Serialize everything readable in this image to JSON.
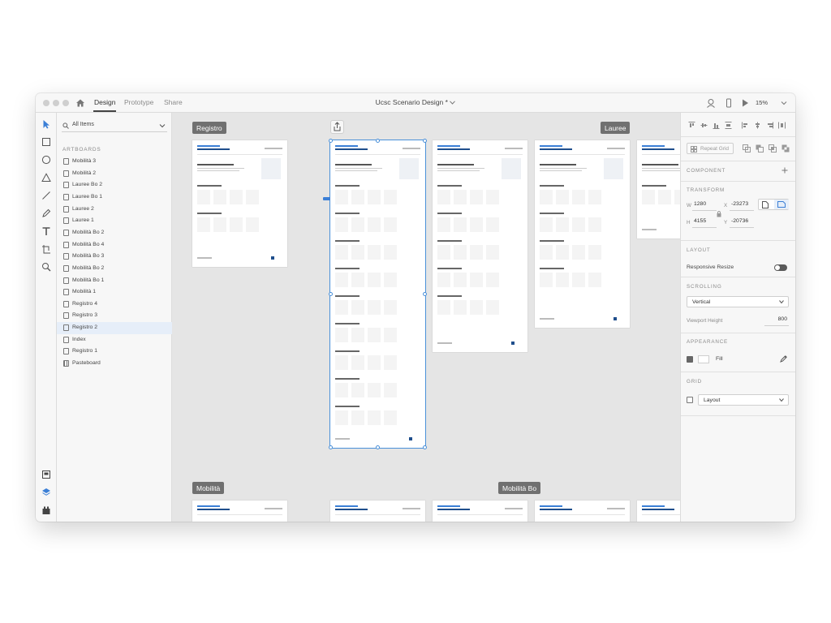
{
  "titlebar": {
    "tabs": [
      {
        "label": "Design",
        "active": true
      },
      {
        "label": "Prototype",
        "active": false
      },
      {
        "label": "Share",
        "active": false
      }
    ],
    "document_title": "Ucsc Scenario Design *",
    "zoom": "15%"
  },
  "layers": {
    "filter_label": "All Items",
    "section_title": "ARTBOARDS",
    "items": [
      {
        "label": "Mobilità 3",
        "selected": false
      },
      {
        "label": "Mobilità 2",
        "selected": false
      },
      {
        "label": "Lauree Bo 2",
        "selected": false
      },
      {
        "label": "Lauree Bo 1",
        "selected": false
      },
      {
        "label": "Lauree 2",
        "selected": false
      },
      {
        "label": "Lauree 1",
        "selected": false
      },
      {
        "label": "Mobilità Bo 2",
        "selected": false
      },
      {
        "label": "Mobilità Bo 4",
        "selected": false
      },
      {
        "label": "Mobilità Bo 3",
        "selected": false
      },
      {
        "label": "Mobilità Bo 2",
        "selected": false
      },
      {
        "label": "Mobilità Bo 1",
        "selected": false
      },
      {
        "label": "Mobilità 1",
        "selected": false
      },
      {
        "label": "Registro 4",
        "selected": false
      },
      {
        "label": "Registro 3",
        "selected": false
      },
      {
        "label": "Registro 2",
        "selected": true
      },
      {
        "label": "Index",
        "selected": false
      },
      {
        "label": "Registro 1",
        "selected": false
      },
      {
        "label": "Pasteboard",
        "selected": false
      }
    ]
  },
  "canvas": {
    "labels": [
      "Registro",
      "Lauree",
      "Mobilità",
      "Mobilità Bo"
    ]
  },
  "properties": {
    "repeat_grid": "Repeat Grid",
    "component_title": "COMPONENT",
    "transform_title": "TRANSFORM",
    "w_label": "W",
    "w_value": "1280",
    "x_label": "X",
    "x_value": "-23273",
    "h_label": "H",
    "h_value": "4155",
    "y_label": "Y",
    "y_value": "-20736",
    "layout_title": "LAYOUT",
    "responsive_resize": "Responsive Resize",
    "scrolling_title": "SCROLLING",
    "scrolling_value": "Vertical",
    "viewport_height_label": "Viewport Height",
    "viewport_height_value": "800",
    "appearance_title": "APPEARANCE",
    "fill_label": "Fill",
    "grid_title": "GRID",
    "grid_value": "Layout"
  },
  "colors": {
    "accent": "#4a90d9",
    "label_bg": "#707070",
    "panel_bg": "#f7f7f7",
    "canvas_bg": "#e5e5e5"
  }
}
